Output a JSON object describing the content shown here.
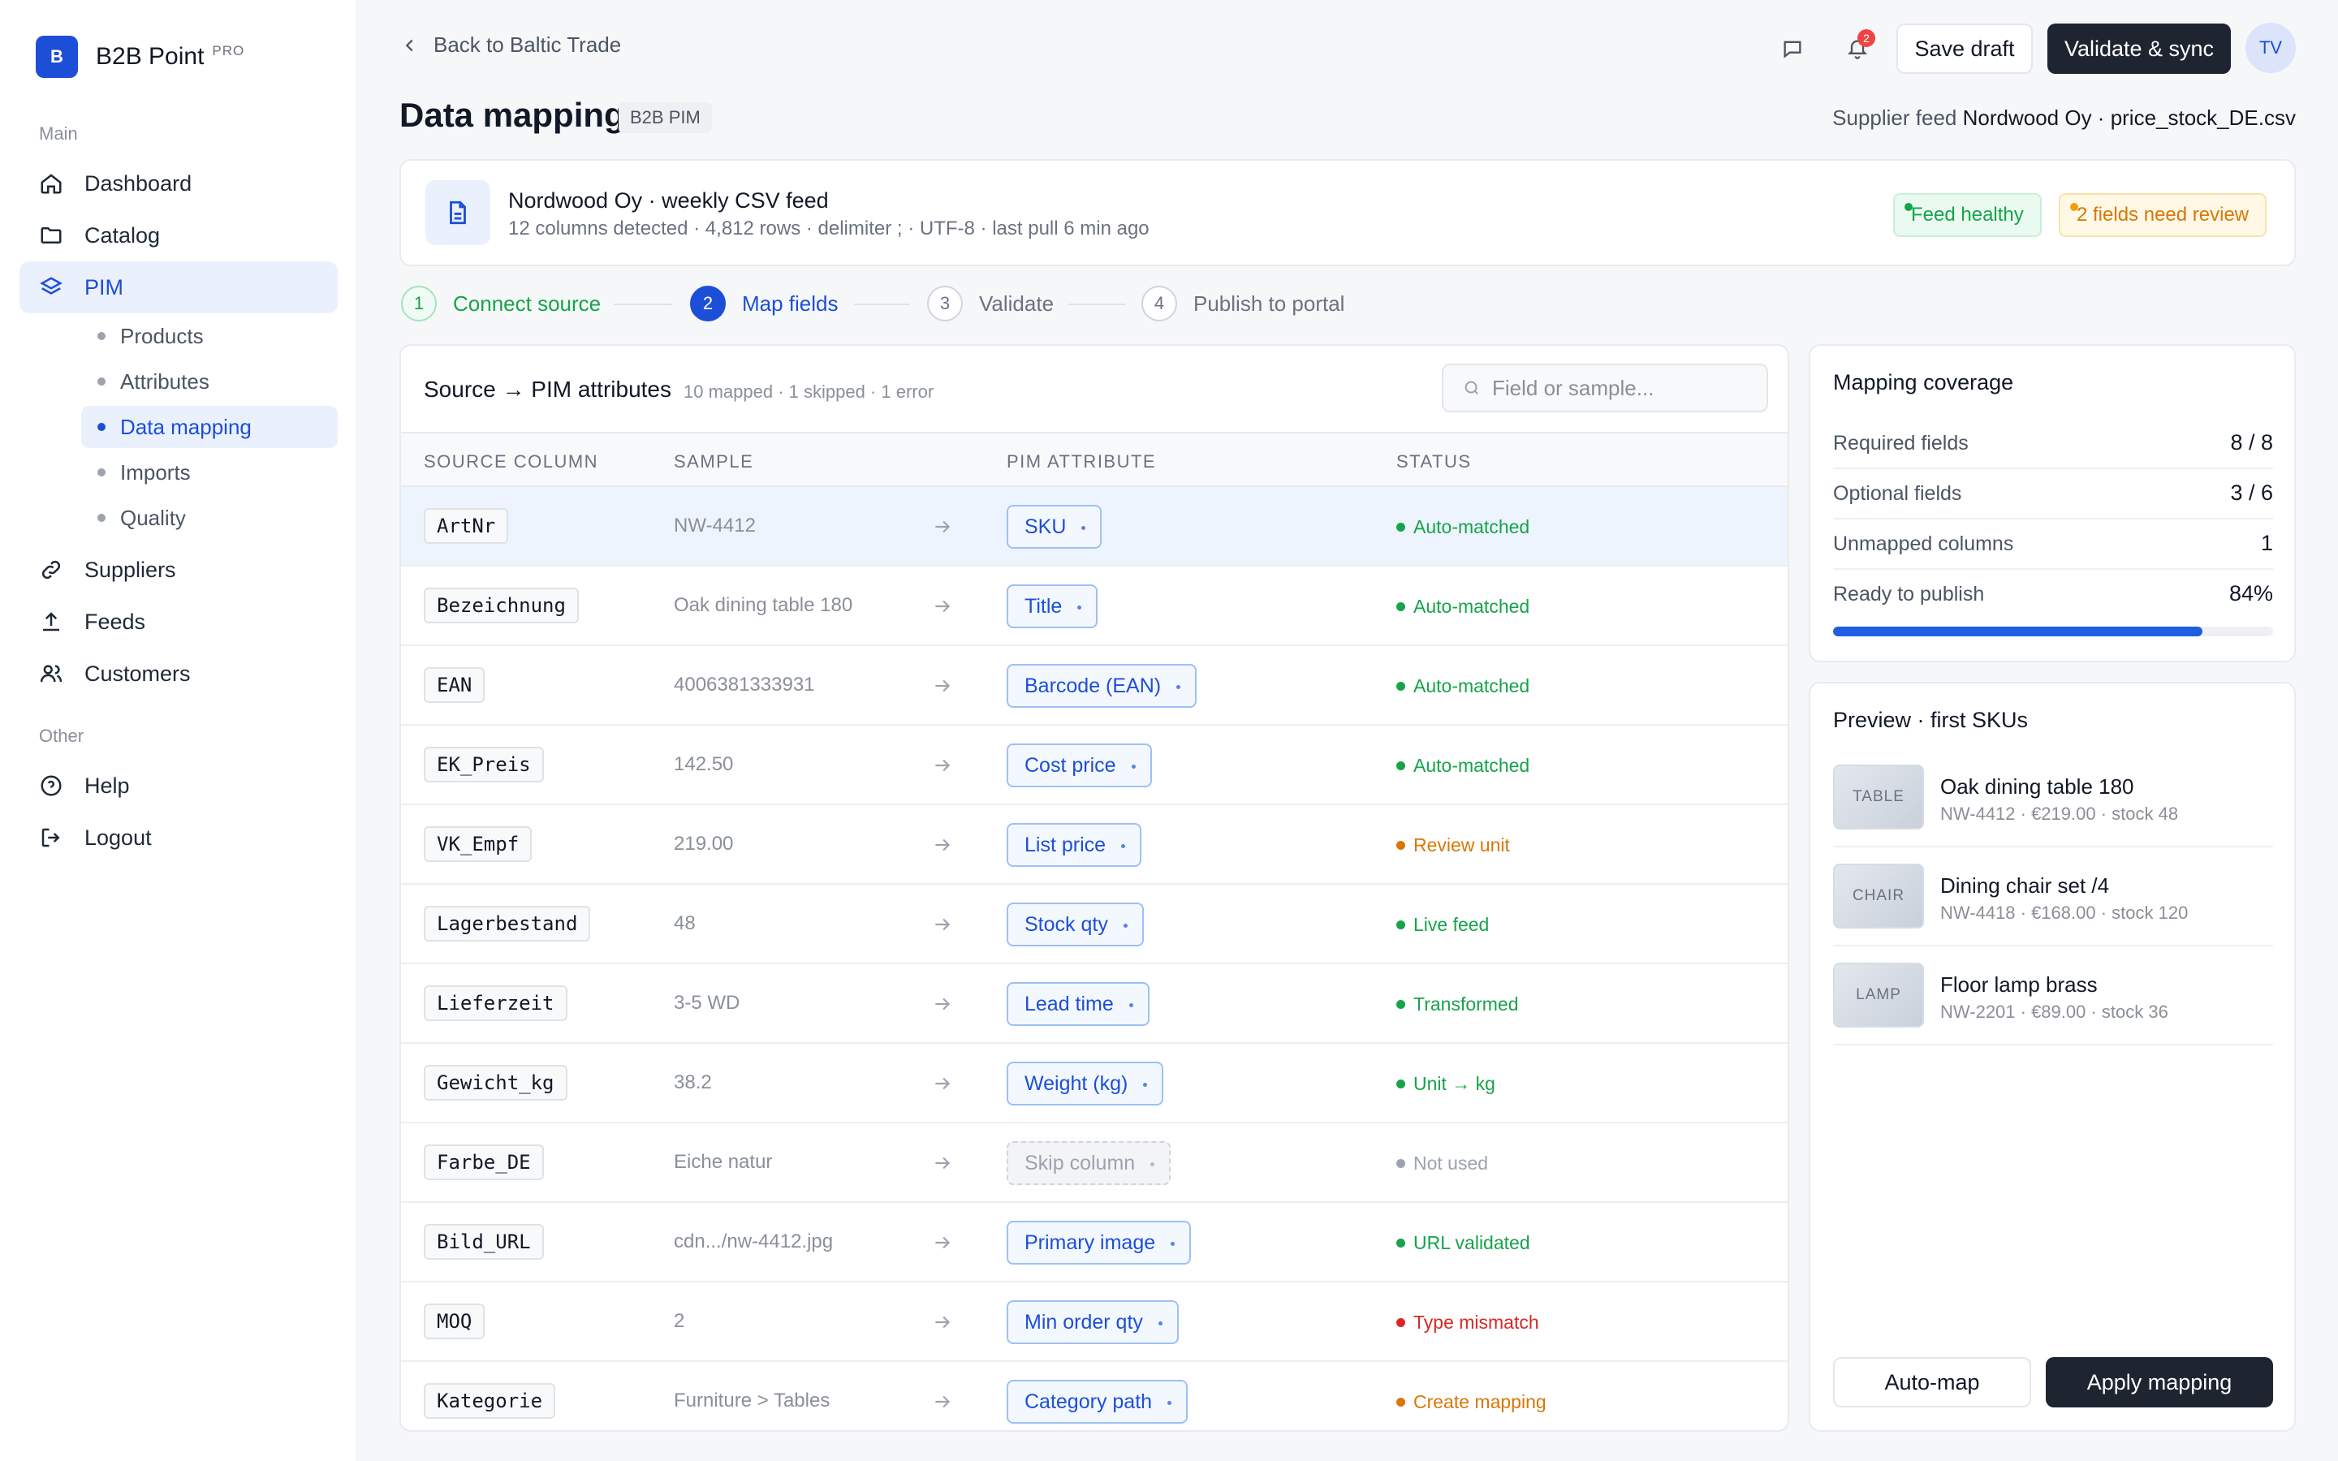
{
  "brand": {
    "logo_letter": "B",
    "name": "B2B Point",
    "badge": "PRO"
  },
  "sidebar": {
    "section_main": "Main",
    "section_other": "Other",
    "items": [
      {
        "label": "Dashboard",
        "icon": "home-icon"
      },
      {
        "label": "Catalog",
        "icon": "folder-icon"
      },
      {
        "label": "PIM",
        "icon": "layers-icon"
      },
      {
        "label": "Suppliers",
        "icon": "link-icon"
      },
      {
        "label": "Feeds",
        "icon": "upload-icon"
      },
      {
        "label": "Customers",
        "icon": "users-icon"
      }
    ],
    "pim_sub": [
      "Products",
      "Attributes",
      "Data mapping",
      "Imports",
      "Quality"
    ],
    "other_items": [
      {
        "label": "Help",
        "icon": "help-icon"
      },
      {
        "label": "Logout",
        "icon": "logout-icon"
      }
    ]
  },
  "header": {
    "back_label": "Back to Baltic Trade",
    "notification_count": "2",
    "save_draft": "Save draft",
    "validate_sync": "Validate & sync",
    "avatar_initials": "TV",
    "page_title": "Data mapping",
    "title_chip": "B2B PIM",
    "supplier_prefix": "Supplier feed",
    "supplier_value": "Nordwood Oy · price_stock_DE.csv"
  },
  "feed": {
    "title": "Nordwood Oy · weekly CSV feed",
    "meta": "12 columns detected · 4,812 rows · delimiter ; · UTF-8 · last pull 6 min ago",
    "healthy": "Feed healthy",
    "review": "2 fields need review"
  },
  "steps": [
    {
      "num": "1",
      "label": "Connect source",
      "state": "done"
    },
    {
      "num": "2",
      "label": "Map fields",
      "state": "current"
    },
    {
      "num": "3",
      "label": "Validate",
      "state": "todo"
    },
    {
      "num": "4",
      "label": "Publish to portal",
      "state": "todo"
    }
  ],
  "mapping": {
    "title": "Source → PIM attributes",
    "stats": "10 mapped · 1 skipped · 1 error",
    "search_placeholder": "Field or sample...",
    "columns": [
      "SOURCE COLUMN",
      "SAMPLE",
      "PIM ATTRIBUTE",
      "STATUS"
    ],
    "rows": [
      {
        "source": "ArtNr",
        "sample": "NW-4412",
        "attribute": "SKU",
        "status": "Auto-matched",
        "tone": "green"
      },
      {
        "source": "Bezeichnung",
        "sample": "Oak dining table 180",
        "attribute": "Title",
        "status": "Auto-matched",
        "tone": "green"
      },
      {
        "source": "EAN",
        "sample": "4006381333931",
        "attribute": "Barcode (EAN)",
        "status": "Auto-matched",
        "tone": "green"
      },
      {
        "source": "EK_Preis",
        "sample": "142.50",
        "attribute": "Cost price",
        "status": "Auto-matched",
        "tone": "green"
      },
      {
        "source": "VK_Empf",
        "sample": "219.00",
        "attribute": "List price",
        "status": "Review unit",
        "tone": "amber"
      },
      {
        "source": "Lagerbestand",
        "sample": "48",
        "attribute": "Stock qty",
        "status": "Live feed",
        "tone": "green"
      },
      {
        "source": "Lieferzeit",
        "sample": "3-5 WD",
        "attribute": "Lead time",
        "status": "Transformed",
        "tone": "green"
      },
      {
        "source": "Gewicht_kg",
        "sample": "38.2",
        "attribute": "Weight (kg)",
        "status": "Unit → kg",
        "tone": "green"
      },
      {
        "source": "Farbe_DE",
        "sample": "Eiche natur",
        "attribute": "Skip column",
        "status": "Not used",
        "tone": "gray"
      },
      {
        "source": "Bild_URL",
        "sample": "cdn.../nw-4412.jpg",
        "attribute": "Primary image",
        "status": "URL validated",
        "tone": "green"
      },
      {
        "source": "MOQ",
        "sample": "2",
        "attribute": "Min order qty",
        "status": "Type mismatch",
        "tone": "red"
      },
      {
        "source": "Kategorie",
        "sample": "Furniture > Tables",
        "attribute": "Category path",
        "status": "Create mapping",
        "tone": "amber"
      }
    ]
  },
  "coverage": {
    "title": "Mapping coverage",
    "rows": [
      {
        "label": "Required fields",
        "value": "8 / 8"
      },
      {
        "label": "Optional fields",
        "value": "3 / 6"
      },
      {
        "label": "Unmapped columns",
        "value": "1"
      },
      {
        "label": "Ready to publish",
        "value": "84%"
      }
    ],
    "ready_fraction": 0.84
  },
  "preview": {
    "title": "Preview · first SKUs",
    "items": [
      {
        "thumb": "TABLE",
        "name": "Oak dining table 180",
        "meta": "NW-4412 · €219.00 · stock 48"
      },
      {
        "thumb": "CHAIR",
        "name": "Dining chair set /4",
        "meta": "NW-4418 · €168.00 · stock 120"
      },
      {
        "thumb": "LAMP",
        "name": "Floor lamp brass",
        "meta": "NW-2201 · €89.00 · stock 36"
      }
    ],
    "auto_map": "Auto-map",
    "apply": "Apply mapping"
  },
  "colors": {
    "accent": "#1d4ed8",
    "success": "#16a34a",
    "warning": "#d97706",
    "error": "#dc2626",
    "dark_button": "#1e2530"
  }
}
